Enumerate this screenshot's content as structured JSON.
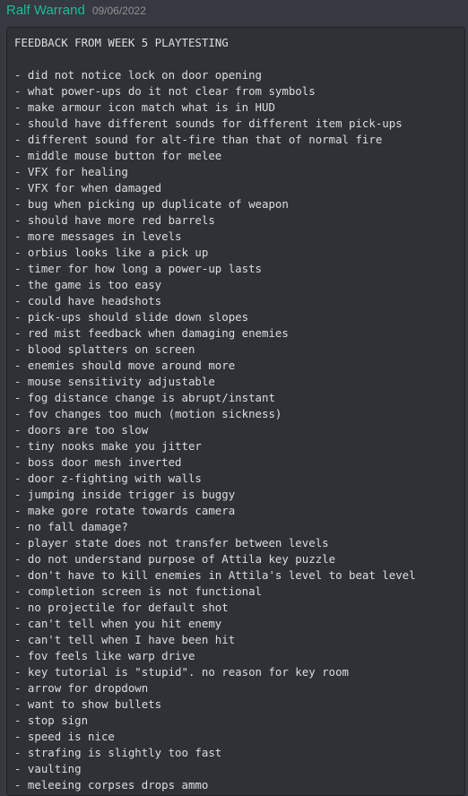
{
  "message": {
    "author": "Ralf Warrand",
    "timestamp": "09/06/2022"
  },
  "code_block": {
    "lines": [
      "FEEDBACK FROM WEEK 5 PLAYTESTING",
      "",
      "- did not notice lock on door opening",
      "- what power-ups do it not clear from symbols",
      "- make armour icon match what is in HUD",
      "- should have different sounds for different item pick-ups",
      "- different sound for alt-fire than that of normal fire",
      "- middle mouse button for melee",
      "- VFX for healing",
      "- VFX for when damaged",
      "- bug when picking up duplicate of weapon",
      "- should have more red barrels",
      "- more messages in levels",
      "- orbius looks like a pick up",
      "- timer for how long a power-up lasts",
      "- the game is too easy",
      "- could have headshots",
      "- pick-ups should slide down slopes",
      "- red mist feedback when damaging enemies",
      "- blood splatters on screen",
      "- enemies should move around more",
      "- mouse sensitivity adjustable",
      "- fog distance change is abrupt/instant",
      "- fov changes too much (motion sickness)",
      "- doors are too slow",
      "- tiny nooks make you jitter",
      "- boss door mesh inverted",
      "- door z-fighting with walls",
      "- jumping inside trigger is buggy",
      "- make gore rotate towards camera",
      "- no fall damage?",
      "- player state does not transfer between levels",
      "- do not understand purpose of Attila key puzzle",
      "- don't have to kill enemies in Attila's level to beat level",
      "- completion screen is not functional",
      "- no projectile for default shot",
      "- can't tell when you hit enemy",
      "- can't tell when I have been hit",
      "- fov feels like warp drive",
      "- key tutorial is \"stupid\". no reason for key room",
      "- arrow for dropdown",
      "- want to show bullets",
      "- stop sign",
      "- speed is nice",
      "- strafing is slightly too fast",
      "- vaulting",
      "- meleeing corpses drops ammo"
    ]
  }
}
